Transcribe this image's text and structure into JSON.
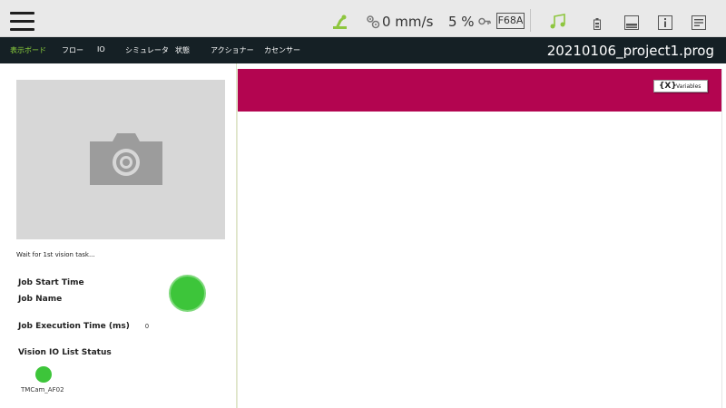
{
  "topbar": {
    "menu_icon": "hamburger-menu-icon",
    "speed": "0 mm/s",
    "percent": "5 %",
    "code": "F68A",
    "icons": [
      "robot-arm-icon",
      "speed-gears-icon",
      "key-icon",
      "music-mode-icon",
      "battery-icon",
      "panel-icon",
      "info-icon",
      "document-icon"
    ],
    "accent_color": "#8ec63f"
  },
  "nav": {
    "tabs": [
      "表示ボード",
      "フロー",
      "IO",
      "シミュレータ",
      "状態",
      "アクショナー",
      "カセンサー"
    ],
    "active_tab": "表示ボード",
    "project": "20210106_project1.prog",
    "active_color": "#8ed43d"
  },
  "left": {
    "camera_icon": "camera-icon",
    "wait_text": "Wait for 1st vision task...",
    "job_start_time_label": "Job Start Time",
    "job_name_label": "Job Name",
    "job_exec_label": "Job Execution Time (ms)",
    "job_exec_value": "0",
    "io_status_label": "Vision IO List Status",
    "io_device": "TMCam_AF02",
    "status_color": "#3dc53a"
  },
  "right": {
    "band_color": "#b30550",
    "variables_icon": "{X}",
    "variables_label": "Variables"
  }
}
